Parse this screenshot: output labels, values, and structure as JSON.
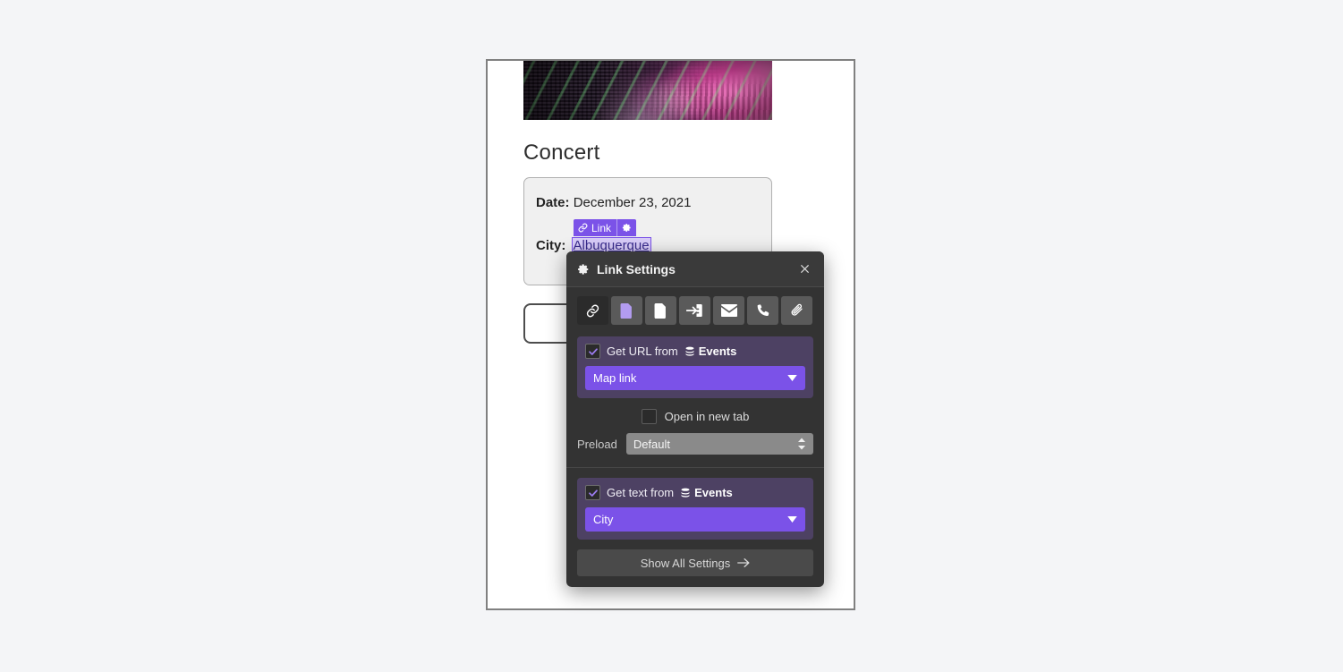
{
  "canvas": {
    "hero_image_alt": "concert-stage-photo",
    "page_title": "Concert",
    "fields": [
      {
        "label": "Date:",
        "value": "December 23, 2021"
      },
      {
        "label": "City:",
        "value": "Albuquerque"
      }
    ],
    "link_badge": {
      "label": "Link",
      "link_icon": "chain-link-icon",
      "settings_icon": "gear-icon"
    }
  },
  "dialog": {
    "title": "Link Settings",
    "title_icon": "gear-icon",
    "close_icon": "close-icon",
    "link_types": [
      {
        "name": "url-link",
        "icon": "chain-link-icon",
        "active": true
      },
      {
        "name": "page-link",
        "icon": "page-filled-icon",
        "active": false
      },
      {
        "name": "file-link",
        "icon": "document-icon",
        "active": false
      },
      {
        "name": "anchor-link",
        "icon": "jump-to-anchor-icon",
        "active": false
      },
      {
        "name": "email-link",
        "icon": "envelope-icon",
        "active": false
      },
      {
        "name": "phone-link",
        "icon": "phone-icon",
        "active": false
      },
      {
        "name": "attachment-link",
        "icon": "paperclip-icon",
        "active": false
      }
    ],
    "url_group": {
      "checkbox_checked": true,
      "label": "Get URL from",
      "source_icon": "database-icon",
      "source_name": "Events",
      "selected_field": "Map link",
      "dropdown_icon": "chevron-down-icon"
    },
    "open_new_tab": {
      "label": "Open in new tab",
      "checked": false
    },
    "preload": {
      "label": "Preload",
      "value": "Default",
      "stepper_icon": "updown-chevron-icon"
    },
    "text_group": {
      "checkbox_checked": true,
      "label": "Get text from",
      "source_icon": "database-icon",
      "source_name": "Events",
      "selected_field": "City",
      "dropdown_icon": "chevron-down-icon"
    },
    "footer": {
      "show_all_label": "Show All Settings",
      "arrow_icon": "arrow-right-icon"
    }
  },
  "colors": {
    "accent_purple": "#7b52e8",
    "group_purple": "#4d4163",
    "dialog_bg": "#333333",
    "canvas_bg": "#ffffff",
    "app_bg": "#f4f5f7"
  }
}
